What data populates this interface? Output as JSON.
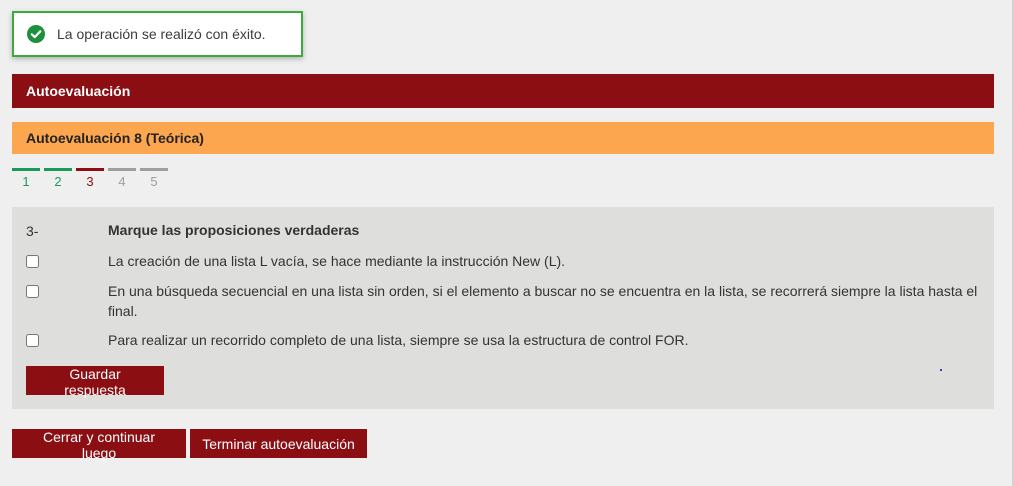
{
  "notification": {
    "message": "La operación se realizó con éxito.",
    "icon": "check-circle-icon",
    "color": "#3bab3b"
  },
  "header": {
    "title": "Autoevaluación",
    "color": "#8b0e13"
  },
  "subheader": {
    "title": "Autoevaluación 8 (Teórica)",
    "color": "#fca64f"
  },
  "steps": [
    {
      "label": "1",
      "state": "done"
    },
    {
      "label": "2",
      "state": "done"
    },
    {
      "label": "3",
      "state": "current"
    },
    {
      "label": "4",
      "state": "pending"
    },
    {
      "label": "5",
      "state": "pending"
    }
  ],
  "question": {
    "number": "3-",
    "title": "Marque las proposiciones verdaderas",
    "options": [
      {
        "text": "La creación de una lista L vacía, se hace mediante la instrucción New (L).",
        "checked": false
      },
      {
        "text": "En una búsqueda secuencial en una lista sin orden, si el elemento a buscar no se encuentra en la lista, se recorrerá siempre la lista hasta el final.",
        "checked": false
      },
      {
        "text": "Para realizar un recorrido completo de una lista, siempre se usa la estructura de control FOR.",
        "checked": false
      }
    ],
    "save_label": "Guardar respuesta"
  },
  "footer": {
    "close_label": "Cerrar y continuar luego",
    "finish_label": "Terminar autoevaluación"
  }
}
